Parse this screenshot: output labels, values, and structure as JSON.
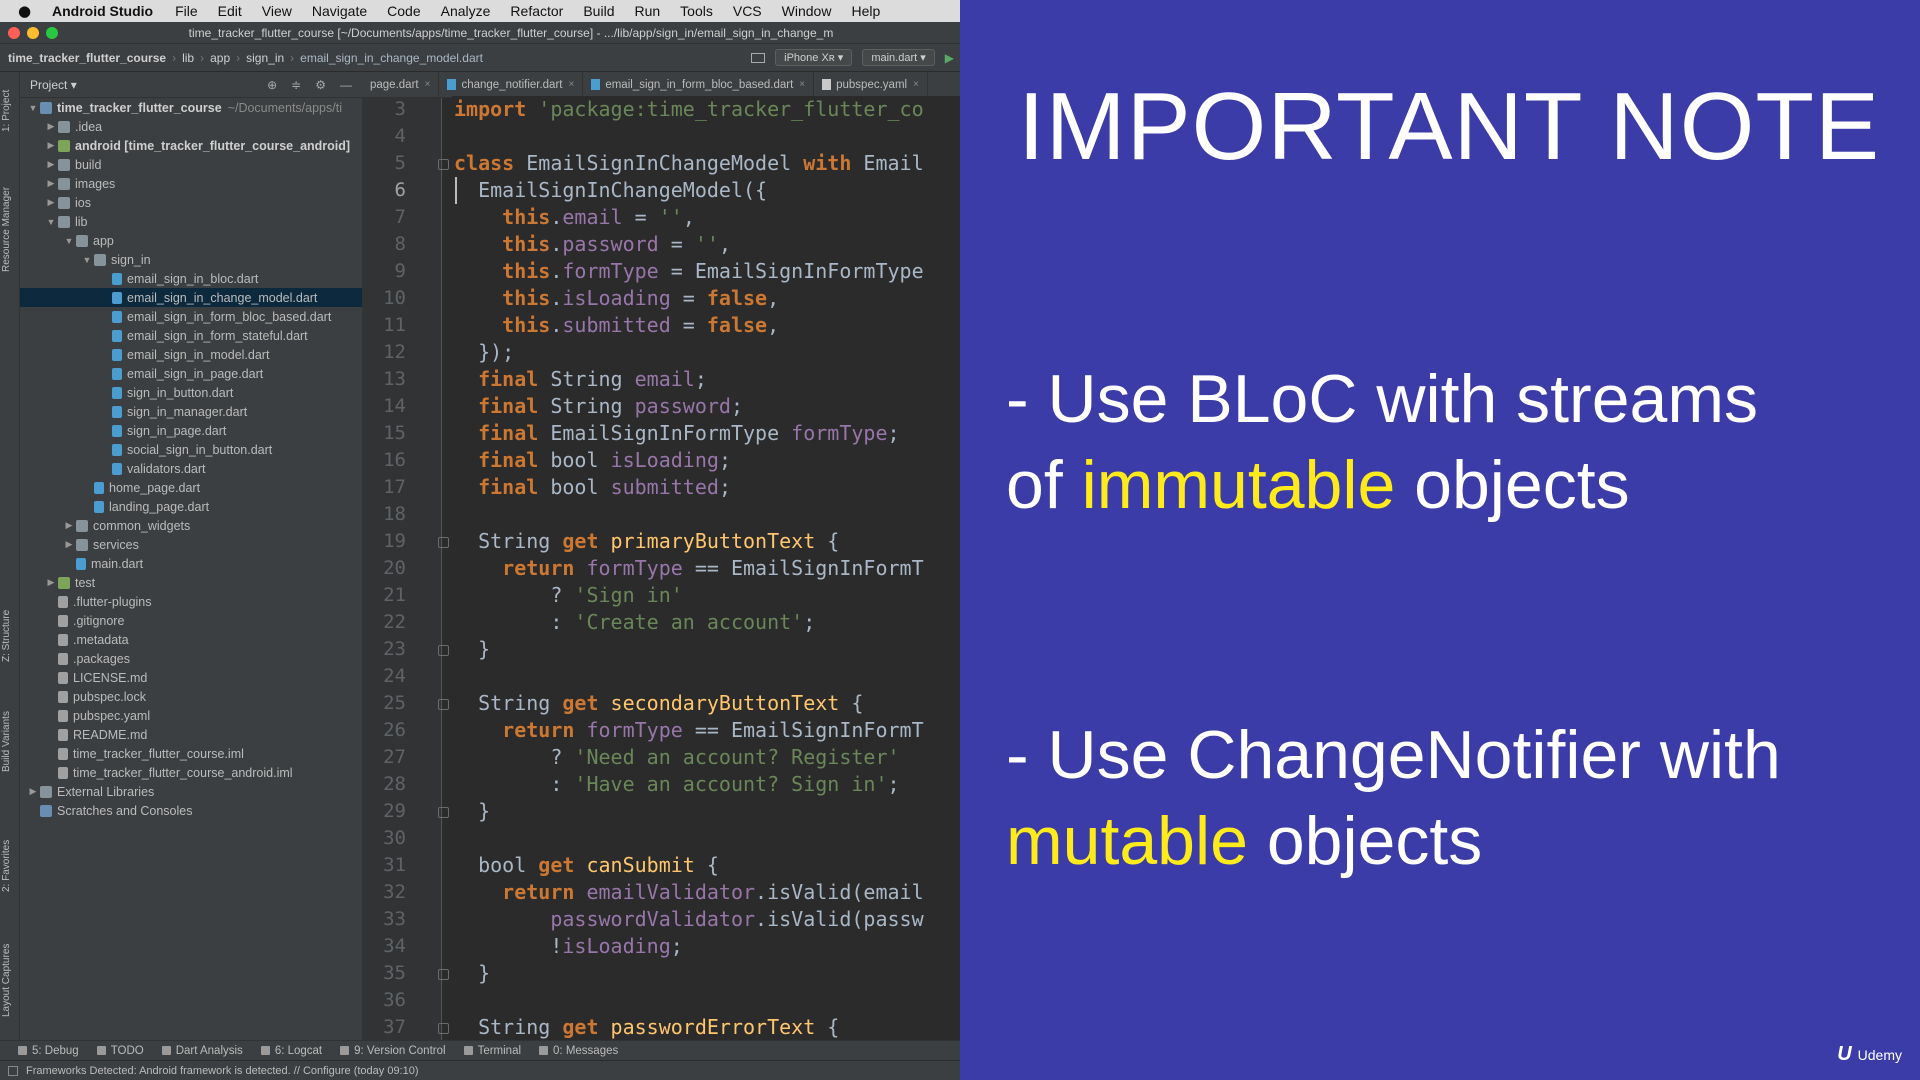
{
  "menubar": {
    "app_name": "Android Studio",
    "items": [
      "File",
      "Edit",
      "View",
      "Navigate",
      "Code",
      "Analyze",
      "Refactor",
      "Build",
      "Run",
      "Tools",
      "VCS",
      "Window",
      "Help"
    ]
  },
  "window": {
    "title": "time_tracker_flutter_course [~/Documents/apps/time_tracker_flutter_course] - .../lib/app/sign_in/email_sign_in_change_m"
  },
  "breadcrumb": {
    "project": "time_tracker_flutter_course",
    "lib": "lib",
    "app": "app",
    "sign_in": "sign_in",
    "file": "email_sign_in_change_model.dart"
  },
  "toolbar": {
    "device": "iPhone Xʀ",
    "run_config": "main.dart"
  },
  "project_panel": {
    "title": "Project",
    "tree": [
      {
        "label": "time_tracker_flutter_course",
        "extra": "~/Documents/apps/ti",
        "indent": 0,
        "arrow": "▼",
        "icon": "fold blue",
        "bold": true
      },
      {
        "label": ".idea",
        "indent": 1,
        "arrow": "▶",
        "icon": "fold"
      },
      {
        "label": "android [time_tracker_flutter_course_android]",
        "indent": 1,
        "arrow": "▶",
        "icon": "fold green",
        "bold": true
      },
      {
        "label": "build",
        "indent": 1,
        "arrow": "▶",
        "icon": "fold"
      },
      {
        "label": "images",
        "indent": 1,
        "arrow": "▶",
        "icon": "fold"
      },
      {
        "label": "ios",
        "indent": 1,
        "arrow": "▶",
        "icon": "fold"
      },
      {
        "label": "lib",
        "indent": 1,
        "arrow": "▼",
        "icon": "fold"
      },
      {
        "label": "app",
        "indent": 2,
        "arrow": "▼",
        "icon": "fold"
      },
      {
        "label": "sign_in",
        "indent": 3,
        "arrow": "▼",
        "icon": "fold"
      },
      {
        "label": "email_sign_in_bloc.dart",
        "indent": 4,
        "arrow": "",
        "icon": "dart"
      },
      {
        "label": "email_sign_in_change_model.dart",
        "indent": 4,
        "arrow": "",
        "icon": "dart",
        "selected": true
      },
      {
        "label": "email_sign_in_form_bloc_based.dart",
        "indent": 4,
        "arrow": "",
        "icon": "dart"
      },
      {
        "label": "email_sign_in_form_stateful.dart",
        "indent": 4,
        "arrow": "",
        "icon": "dart"
      },
      {
        "label": "email_sign_in_model.dart",
        "indent": 4,
        "arrow": "",
        "icon": "dart"
      },
      {
        "label": "email_sign_in_page.dart",
        "indent": 4,
        "arrow": "",
        "icon": "dart"
      },
      {
        "label": "sign_in_button.dart",
        "indent": 4,
        "arrow": "",
        "icon": "dart"
      },
      {
        "label": "sign_in_manager.dart",
        "indent": 4,
        "arrow": "",
        "icon": "dart"
      },
      {
        "label": "sign_in_page.dart",
        "indent": 4,
        "arrow": "",
        "icon": "dart"
      },
      {
        "label": "social_sign_in_button.dart",
        "indent": 4,
        "arrow": "",
        "icon": "dart"
      },
      {
        "label": "validators.dart",
        "indent": 4,
        "arrow": "",
        "icon": "dart"
      },
      {
        "label": "home_page.dart",
        "indent": 3,
        "arrow": "",
        "icon": "dart"
      },
      {
        "label": "landing_page.dart",
        "indent": 3,
        "arrow": "",
        "icon": "dart"
      },
      {
        "label": "common_widgets",
        "indent": 2,
        "arrow": "▶",
        "icon": "fold"
      },
      {
        "label": "services",
        "indent": 2,
        "arrow": "▶",
        "icon": "fold"
      },
      {
        "label": "main.dart",
        "indent": 2,
        "arrow": "",
        "icon": "dart"
      },
      {
        "label": "test",
        "indent": 1,
        "arrow": "▶",
        "icon": "fold green"
      },
      {
        "label": ".flutter-plugins",
        "indent": 1,
        "arrow": "",
        "icon": "txt"
      },
      {
        "label": ".gitignore",
        "indent": 1,
        "arrow": "",
        "icon": "txt"
      },
      {
        "label": ".metadata",
        "indent": 1,
        "arrow": "",
        "icon": "txt"
      },
      {
        "label": ".packages",
        "indent": 1,
        "arrow": "",
        "icon": "txt"
      },
      {
        "label": "LICENSE.md",
        "indent": 1,
        "arrow": "",
        "icon": "txt"
      },
      {
        "label": "pubspec.lock",
        "indent": 1,
        "arrow": "",
        "icon": "txt"
      },
      {
        "label": "pubspec.yaml",
        "indent": 1,
        "arrow": "",
        "icon": "txt"
      },
      {
        "label": "README.md",
        "indent": 1,
        "arrow": "",
        "icon": "txt"
      },
      {
        "label": "time_tracker_flutter_course.iml",
        "indent": 1,
        "arrow": "",
        "icon": "txt"
      },
      {
        "label": "time_tracker_flutter_course_android.iml",
        "indent": 1,
        "arrow": "",
        "icon": "txt"
      },
      {
        "label": "External Libraries",
        "indent": 0,
        "arrow": "▶",
        "icon": "fold"
      },
      {
        "label": "Scratches and Consoles",
        "indent": 0,
        "arrow": "",
        "icon": "fold blue"
      }
    ]
  },
  "side_labels": {
    "project": "1: Project",
    "resource_manager": "Resource Manager",
    "structure": "Z: Structure",
    "build_variants": "Build Variants",
    "favorites": "2: Favorites",
    "layout_captures": "Layout Captures"
  },
  "editor_tabs": [
    {
      "label": "page.dart",
      "icon": "none",
      "active": false
    },
    {
      "label": "change_notifier.dart",
      "icon": "dart",
      "active": false
    },
    {
      "label": "email_sign_in_form_bloc_based.dart",
      "icon": "dart",
      "active": false
    },
    {
      "label": "pubspec.yaml",
      "icon": "yaml",
      "active": false
    }
  ],
  "code": {
    "first_line": 3,
    "current_line": 6,
    "fold_lines": [
      5,
      19,
      23,
      25,
      29,
      35,
      37
    ],
    "lines": [
      [
        [
          "k",
          "import "
        ],
        [
          "s",
          "'package:time_tracker_flutter_co"
        ]
      ],
      [],
      [
        [
          "k",
          "class "
        ],
        [
          "n",
          "EmailSignInChangeModel "
        ],
        [
          "k",
          "with "
        ],
        [
          "n",
          "Email"
        ]
      ],
      [
        [
          "n",
          "  EmailSignInChangeModel({"
        ]
      ],
      [
        [
          "n",
          "    "
        ],
        [
          "k",
          "this"
        ],
        [
          "n",
          "."
        ],
        [
          "p",
          "email"
        ],
        [
          "n",
          " = "
        ],
        [
          "s",
          "''"
        ],
        [
          "n",
          ","
        ]
      ],
      [
        [
          "n",
          "    "
        ],
        [
          "k",
          "this"
        ],
        [
          "n",
          "."
        ],
        [
          "p",
          "password"
        ],
        [
          "n",
          " = "
        ],
        [
          "s",
          "''"
        ],
        [
          "n",
          ","
        ]
      ],
      [
        [
          "n",
          "    "
        ],
        [
          "k",
          "this"
        ],
        [
          "n",
          "."
        ],
        [
          "p",
          "formType"
        ],
        [
          "n",
          " = EmailSignInFormType"
        ]
      ],
      [
        [
          "n",
          "    "
        ],
        [
          "k",
          "this"
        ],
        [
          "n",
          "."
        ],
        [
          "p",
          "isLoading"
        ],
        [
          "n",
          " = "
        ],
        [
          "k",
          "false"
        ],
        [
          "n",
          ","
        ]
      ],
      [
        [
          "n",
          "    "
        ],
        [
          "k",
          "this"
        ],
        [
          "n",
          "."
        ],
        [
          "p",
          "submitted"
        ],
        [
          "n",
          " = "
        ],
        [
          "k",
          "false"
        ],
        [
          "n",
          ","
        ]
      ],
      [
        [
          "n",
          "  });"
        ]
      ],
      [
        [
          "n",
          "  "
        ],
        [
          "k",
          "final "
        ],
        [
          "n",
          "String "
        ],
        [
          "p",
          "email"
        ],
        [
          "n",
          ";"
        ]
      ],
      [
        [
          "n",
          "  "
        ],
        [
          "k",
          "final "
        ],
        [
          "n",
          "String "
        ],
        [
          "p",
          "password"
        ],
        [
          "n",
          ";"
        ]
      ],
      [
        [
          "n",
          "  "
        ],
        [
          "k",
          "final "
        ],
        [
          "n",
          "EmailSignInFormType "
        ],
        [
          "p",
          "formType"
        ],
        [
          "n",
          ";"
        ]
      ],
      [
        [
          "n",
          "  "
        ],
        [
          "k",
          "final "
        ],
        [
          "n",
          "bool "
        ],
        [
          "p",
          "isLoading"
        ],
        [
          "n",
          ";"
        ]
      ],
      [
        [
          "n",
          "  "
        ],
        [
          "k",
          "final "
        ],
        [
          "n",
          "bool "
        ],
        [
          "p",
          "submitted"
        ],
        [
          "n",
          ";"
        ]
      ],
      [],
      [
        [
          "n",
          "  String "
        ],
        [
          "k",
          "get "
        ],
        [
          "f",
          "primaryButtonText"
        ],
        [
          "n",
          " {"
        ]
      ],
      [
        [
          "n",
          "    "
        ],
        [
          "k",
          "return "
        ],
        [
          "p",
          "formType"
        ],
        [
          "n",
          " == EmailSignInFormT"
        ]
      ],
      [
        [
          "n",
          "        ? "
        ],
        [
          "s",
          "'Sign in'"
        ]
      ],
      [
        [
          "n",
          "        : "
        ],
        [
          "s",
          "'Create an account'"
        ],
        [
          "n",
          ";"
        ]
      ],
      [
        [
          "n",
          "  }"
        ]
      ],
      [],
      [
        [
          "n",
          "  String "
        ],
        [
          "k",
          "get "
        ],
        [
          "f",
          "secondaryButtonText"
        ],
        [
          "n",
          " {"
        ]
      ],
      [
        [
          "n",
          "    "
        ],
        [
          "k",
          "return "
        ],
        [
          "p",
          "formType"
        ],
        [
          "n",
          " == EmailSignInFormT"
        ]
      ],
      [
        [
          "n",
          "        ? "
        ],
        [
          "s",
          "'Need an account? Register'"
        ]
      ],
      [
        [
          "n",
          "        : "
        ],
        [
          "s",
          "'Have an account? Sign in'"
        ],
        [
          "n",
          ";"
        ]
      ],
      [
        [
          "n",
          "  }"
        ]
      ],
      [],
      [
        [
          "n",
          "  bool "
        ],
        [
          "k",
          "get "
        ],
        [
          "f",
          "canSubmit"
        ],
        [
          "n",
          " {"
        ]
      ],
      [
        [
          "n",
          "    "
        ],
        [
          "k",
          "return "
        ],
        [
          "p",
          "emailValidator"
        ],
        [
          "n",
          ".isValid(email"
        ]
      ],
      [
        [
          "n",
          "        "
        ],
        [
          "p",
          "passwordValidator"
        ],
        [
          "n",
          ".isValid(passw"
        ]
      ],
      [
        [
          "n",
          "        !"
        ],
        [
          "p",
          "isLoading"
        ],
        [
          "n",
          ";"
        ]
      ],
      [
        [
          "n",
          "  }"
        ]
      ],
      [],
      [
        [
          "n",
          "  String "
        ],
        [
          "k",
          "get "
        ],
        [
          "f",
          "passwordErrorText"
        ],
        [
          "n",
          " {"
        ]
      ]
    ]
  },
  "bottom_tools": [
    {
      "label": "5: Debug"
    },
    {
      "label": "TODO"
    },
    {
      "label": "Dart Analysis"
    },
    {
      "label": "6: Logcat"
    },
    {
      "label": "9: Version Control"
    },
    {
      "label": "Terminal"
    },
    {
      "label": "0: Messages"
    }
  ],
  "status": {
    "message": "Frameworks Detected: Android framework is detected. // Configure (today 09:10)"
  },
  "slide": {
    "title": "IMPORTANT NOTE",
    "bullet1_prefix": "- Use BLoC with streams",
    "bullet1_of": "of ",
    "bullet1_highlight": "immutable",
    "bullet1_suffix": " objects",
    "bullet2_prefix": "- Use ChangeNotifier with",
    "bullet2_highlight": "mutable",
    "bullet2_suffix": " objects",
    "brand": "Udemy",
    "background_color": "#3c3ca8",
    "highlight_color": "#ffeb1a"
  }
}
